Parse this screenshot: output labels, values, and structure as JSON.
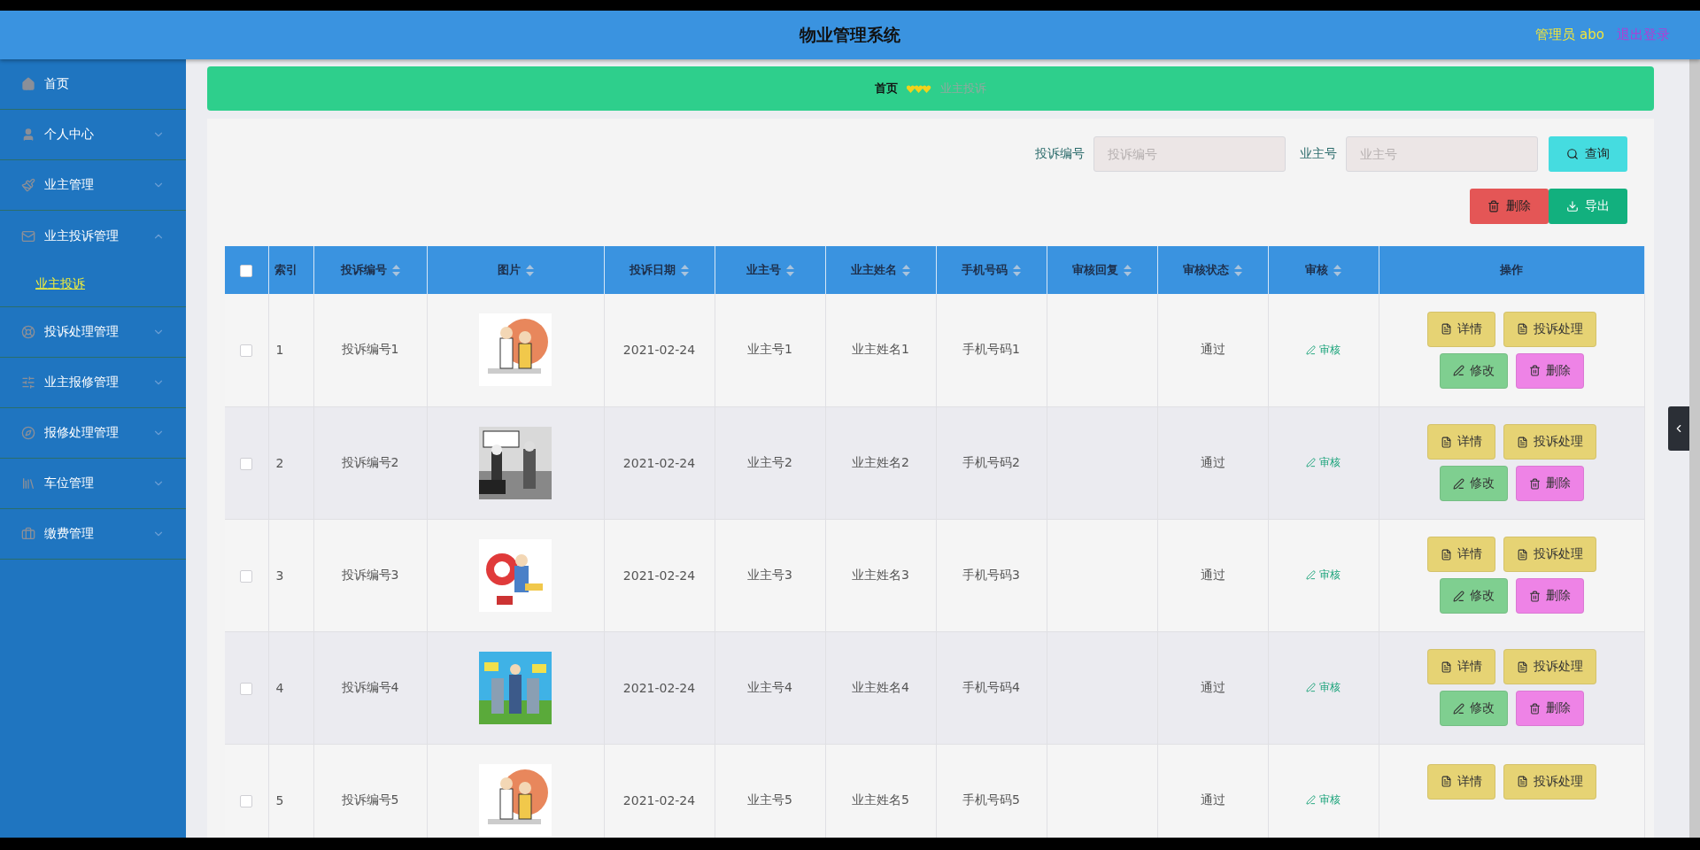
{
  "header": {
    "title": "物业管理系统",
    "user": "管理员 abo",
    "logout": "退出登录"
  },
  "sidebar": {
    "items": [
      {
        "label": "首页",
        "kind": "link",
        "expanded": false
      },
      {
        "label": "个人中心",
        "kind": "menu",
        "expanded": false
      },
      {
        "label": "业主管理",
        "kind": "menu",
        "expanded": false
      },
      {
        "label": "业主投诉管理",
        "kind": "menu",
        "expanded": true,
        "children": [
          {
            "label": "业主投诉",
            "selected": true
          }
        ]
      },
      {
        "label": "投诉处理管理",
        "kind": "menu",
        "expanded": false
      },
      {
        "label": "业主报修管理",
        "kind": "menu",
        "expanded": false
      },
      {
        "label": "报修处理管理",
        "kind": "menu",
        "expanded": false
      },
      {
        "label": "车位管理",
        "kind": "menu",
        "expanded": false
      },
      {
        "label": "缴费管理",
        "kind": "menu",
        "expanded": false
      }
    ]
  },
  "breadcrumb": [
    {
      "label": "首页",
      "current": false
    },
    {
      "label": "业主投诉",
      "current": true
    }
  ],
  "search": {
    "fields": [
      {
        "label": "投诉编号",
        "placeholder": "投诉编号"
      },
      {
        "label": "业主号",
        "placeholder": "业主号"
      }
    ],
    "button": "查询"
  },
  "toolbar": [
    {
      "label": "删除",
      "kind": "delete"
    },
    {
      "label": "导出",
      "kind": "export"
    }
  ],
  "table": {
    "select_all": {
      "checked": false
    },
    "columns": [
      {
        "label": "索引",
        "sortable": false
      },
      {
        "label": "投诉编号",
        "sortable": true
      },
      {
        "label": "图片",
        "sortable": true
      },
      {
        "label": "投诉日期",
        "sortable": true
      },
      {
        "label": "业主号",
        "sortable": true
      },
      {
        "label": "业主姓名",
        "sortable": true
      },
      {
        "label": "手机号码",
        "sortable": true
      },
      {
        "label": "审核回复",
        "sortable": true
      },
      {
        "label": "审核状态",
        "sortable": true
      },
      {
        "label": "审核",
        "sortable": true
      },
      {
        "label": "操作",
        "sortable": false
      }
    ],
    "rows": [
      {
        "checked": false,
        "index": "1",
        "code": "投诉编号1",
        "picture": {
          "kind": "picture"
        },
        "date": "2021-02-24",
        "owner_no": "业主号1",
        "owner_name": "业主姓名1",
        "phone": "手机号码1",
        "status": "通过",
        "review": "审核",
        "actions": [
          {
            "label": "详情",
            "kind": "detail"
          },
          {
            "label": "投诉处理",
            "kind": "process"
          },
          {
            "label": "修改",
            "kind": "edit"
          },
          {
            "label": "删除",
            "kind": "delete"
          }
        ]
      },
      {
        "checked": false,
        "index": "2",
        "code": "投诉编号2",
        "picture": {
          "kind": "picture"
        },
        "date": "2021-02-24",
        "owner_no": "业主号2",
        "owner_name": "业主姓名2",
        "phone": "手机号码2",
        "status": "通过",
        "review": "审核",
        "actions": [
          {
            "label": "详情",
            "kind": "detail"
          },
          {
            "label": "投诉处理",
            "kind": "process"
          },
          {
            "label": "修改",
            "kind": "edit"
          },
          {
            "label": "删除",
            "kind": "delete"
          }
        ]
      },
      {
        "checked": false,
        "index": "3",
        "code": "投诉编号3",
        "picture": {
          "kind": "picture"
        },
        "date": "2021-02-24",
        "owner_no": "业主号3",
        "owner_name": "业主姓名3",
        "phone": "手机号码3",
        "status": "通过",
        "review": "审核",
        "actions": [
          {
            "label": "详情",
            "kind": "detail"
          },
          {
            "label": "投诉处理",
            "kind": "process"
          },
          {
            "label": "修改",
            "kind": "edit"
          },
          {
            "label": "删除",
            "kind": "delete"
          }
        ]
      },
      {
        "checked": false,
        "index": "4",
        "code": "投诉编号4",
        "picture": {
          "kind": "picture"
        },
        "date": "2021-02-24",
        "owner_no": "业主号4",
        "owner_name": "业主姓名4",
        "phone": "手机号码4",
        "status": "通过",
        "review": "审核",
        "actions": [
          {
            "label": "详情",
            "kind": "detail"
          },
          {
            "label": "投诉处理",
            "kind": "process"
          },
          {
            "label": "修改",
            "kind": "edit"
          },
          {
            "label": "删除",
            "kind": "delete"
          }
        ]
      },
      {
        "checked": false,
        "index": "5",
        "code": "投诉编号5",
        "picture": {
          "kind": "picture"
        },
        "date": "2021-02-24",
        "owner_no": "业主号5",
        "owner_name": "业主姓名5",
        "phone": "手机号码5",
        "status": "通过",
        "review": "审核",
        "actions": [
          {
            "label": "详情",
            "kind": "detail"
          },
          {
            "label": "投诉处理",
            "kind": "process"
          }
        ]
      }
    ]
  }
}
